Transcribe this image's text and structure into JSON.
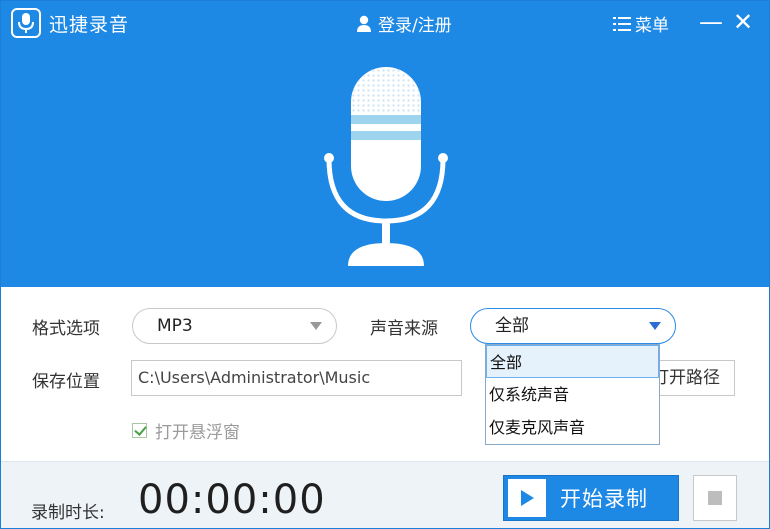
{
  "app": {
    "title": "迅捷录音"
  },
  "titlebar": {
    "login_label": "登录/注册",
    "menu_label": "菜单",
    "minimize_glyph": "—",
    "close_glyph": "✕"
  },
  "settings": {
    "format_label": "格式选项",
    "format_value": "MP3",
    "source_label": "声音来源",
    "source_value": "全部",
    "source_options": [
      "全部",
      "仅系统声音",
      "仅麦克风声音"
    ],
    "save_label": "保存位置",
    "save_path": "C:\\Users\\Administrator\\Music",
    "open_path_label": "打开路径",
    "float_window_label": "打开悬浮窗",
    "float_window_checked": true
  },
  "footer": {
    "duration_label": "录制时长:",
    "timer": "00:00:00",
    "start_label": "开始录制"
  },
  "colors": {
    "brand": "#1e88e5",
    "mic_highlight": "#9fd4ef"
  },
  "icons": [
    "mic-logo-icon",
    "user-icon",
    "menu-icon",
    "microphone-icon",
    "play-icon",
    "stop-icon",
    "dropdown-arrow-icon",
    "checkmark-icon"
  ]
}
